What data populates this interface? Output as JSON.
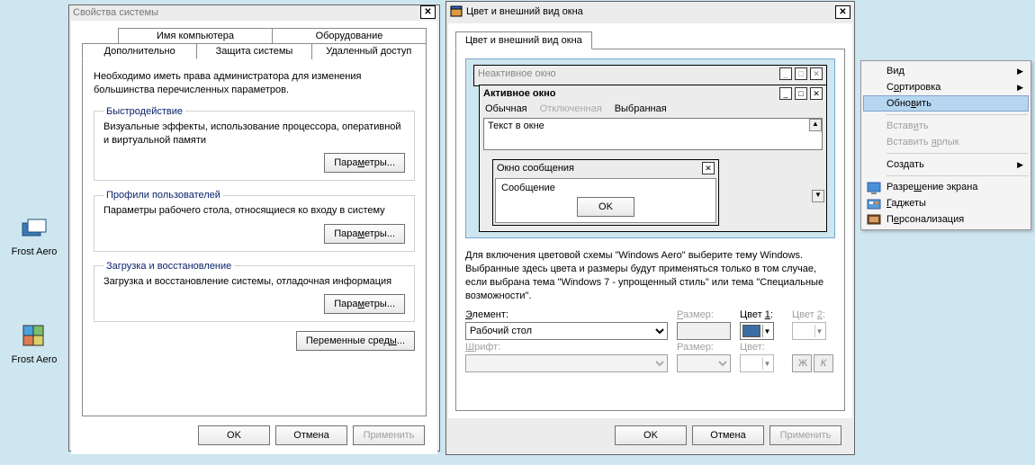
{
  "desktop": {
    "icon1_label": "Frost Aero",
    "icon2_label": "Frost Aero"
  },
  "sysprops": {
    "title": "Свойства системы",
    "tabs_top": [
      "Имя компьютера",
      "Оборудование"
    ],
    "tabs_bottom": [
      "Дополнительно",
      "Защита системы",
      "Удаленный доступ"
    ],
    "note": "Необходимо иметь права администратора для изменения большинства перечисленных параметров.",
    "perf_legend": "Быстродействие",
    "perf_text": "Визуальные эффекты, использование процессора, оперативной и виртуальной памяти",
    "params_btn": "Параметры...",
    "profiles_legend": "Профили пользователей",
    "profiles_text": "Параметры рабочего стола, относящиеся ко входу в систему",
    "startup_legend": "Загрузка и восстановление",
    "startup_text": "Загрузка и восстановление системы, отладочная информация",
    "envvars_btn": "Переменные среды...",
    "ok": "OK",
    "cancel": "Отмена",
    "apply": "Применить"
  },
  "appearance": {
    "title": "Цвет и внешний вид окна",
    "tab": "Цвет и внешний вид окна",
    "inactive_title": "Неактивное окно",
    "active_title": "Активное окно",
    "menu_normal": "Обычная",
    "menu_disabled": "Отключенная",
    "menu_selected": "Выбранная",
    "text_in_window": "Текст в окне",
    "msg_title": "Окно сообщения",
    "msg_text": "Сообщение",
    "msg_ok": "OK",
    "desc": "Для включения цветовой схемы \"Windows Aero\" выберите тему Windows. Выбранные здесь цвета и размеры будут применяться только в том случае, если выбрана тема \"Windows 7 - упрощенный стиль\" или тема \"Специальные возможности\".",
    "element_label": "Элемент:",
    "element_value": "Рабочий стол",
    "size_label": "Размер:",
    "color1_label": "Цвет 1:",
    "color2_label": "Цвет 2:",
    "font_label": "Шрифт:",
    "size2_label": "Размер:",
    "color_label": "Цвет:",
    "bold": "Ж",
    "italic": "К",
    "ok": "OK",
    "cancel": "Отмена",
    "apply": "Применить"
  },
  "ctx": {
    "view": "Вид",
    "sort": "Сортировка",
    "refresh": "Обновить",
    "paste": "Вставить",
    "paste_shortcut": "Вставить ярлык",
    "create": "Создать",
    "resolution": "Разрешение экрана",
    "gadgets": "Гаджеты",
    "personalize": "Персонализация"
  }
}
